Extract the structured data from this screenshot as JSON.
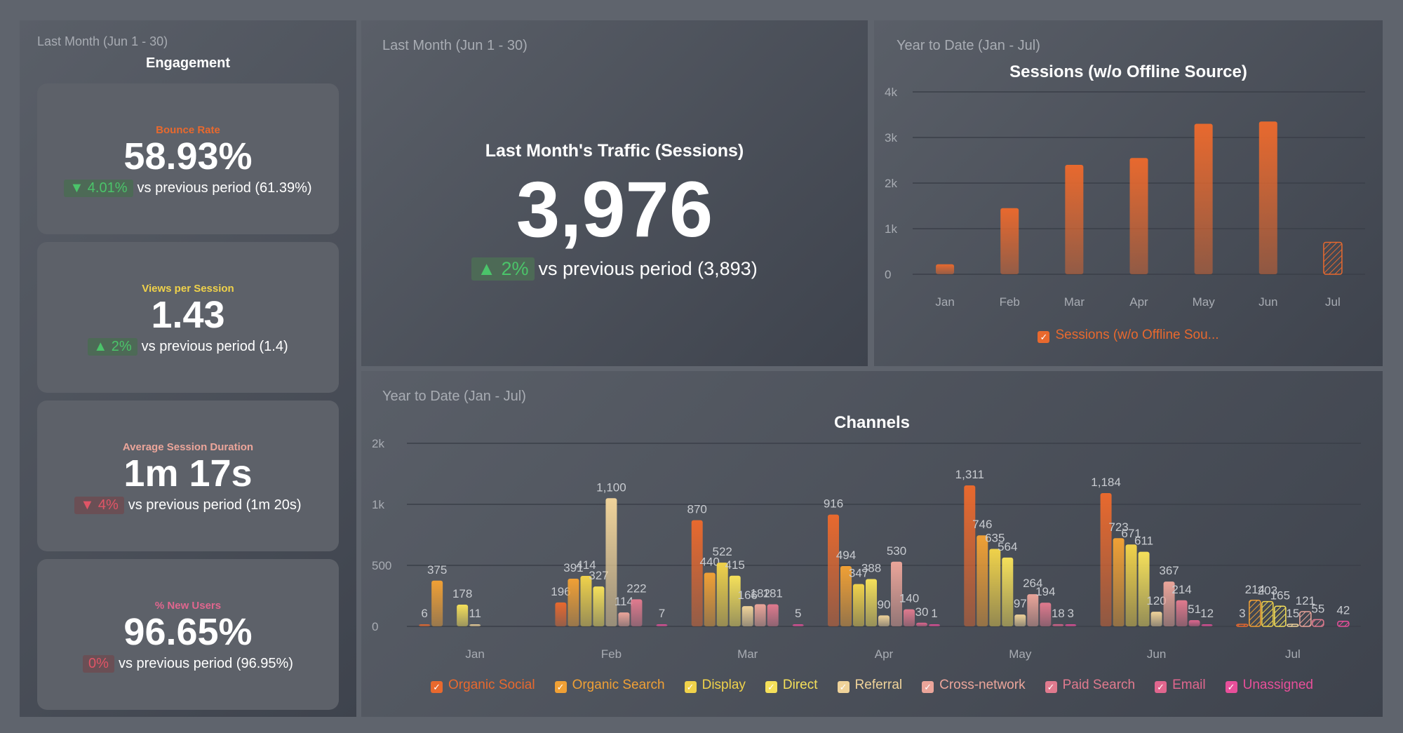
{
  "engagement": {
    "period": "Last Month (Jun 1 - 30)",
    "title": "Engagement",
    "cards": [
      {
        "label": "Bounce Rate",
        "label_color": "#e8692e",
        "value": "58.93%",
        "change": "▼ 4.01%",
        "direction": "down-good",
        "compare": "vs previous period (61.39%)"
      },
      {
        "label": "Views per Session",
        "label_color": "#f0d24a",
        "value": "1.43",
        "change": "▲ 2%",
        "direction": "up",
        "compare": "vs previous period (1.4)"
      },
      {
        "label": "Average Session Duration",
        "label_color": "#eba59a",
        "value": "1m 17s",
        "change": "▼ 4%",
        "direction": "down",
        "compare": "vs previous period (1m 20s)"
      },
      {
        "label": "% New Users",
        "label_color": "#e0668e",
        "value": "96.65%",
        "change": "0%",
        "direction": "down",
        "compare": "vs previous period (96.95%)"
      }
    ]
  },
  "traffic": {
    "period": "Last Month (Jun 1 - 30)",
    "title": "Last Month's Traffic (Sessions)",
    "value": "3,976",
    "change": "▲ 2%",
    "compare": "vs previous period (3,893)"
  },
  "chart_data": [
    {
      "type": "bar",
      "period": "Year to Date (Jan - Jul)",
      "title": "Sessions (w/o Offline Source)",
      "categories": [
        "Jan",
        "Feb",
        "Mar",
        "Apr",
        "May",
        "Jun",
        "Jul"
      ],
      "y_ticks": [
        "0",
        "1k",
        "2k",
        "3k",
        "4k"
      ],
      "ylim": [
        0,
        4000
      ],
      "grid": true,
      "legend": "bottom",
      "series": [
        {
          "name": "Sessions (w/o Offline Sou...",
          "color": "#e8692e",
          "values": [
            220,
            1450,
            2400,
            2550,
            3300,
            3350,
            700
          ]
        }
      ],
      "partial_last": true
    },
    {
      "type": "bar",
      "period": "Year to Date (Jan - Jul)",
      "title": "Channels",
      "categories": [
        "Jan",
        "Feb",
        "Mar",
        "Apr",
        "May",
        "Jun",
        "Jul"
      ],
      "y_ticks": [
        "0",
        "500",
        "1k",
        "2k"
      ],
      "ylim": [
        0,
        1500
      ],
      "grid": true,
      "legend": "bottom",
      "partial_last": true,
      "series": [
        {
          "name": "Organic Social",
          "color": "#e8692e",
          "values": [
            6,
            196,
            870,
            916,
            1311,
            1184,
            3
          ]
        },
        {
          "name": "Organic Search",
          "color": "#f0a035",
          "values": [
            375,
            391,
            440,
            494,
            746,
            723,
            214
          ]
        },
        {
          "name": "Display",
          "color": "#f0d24a",
          "values": [
            null,
            414,
            522,
            347,
            635,
            671,
            203
          ]
        },
        {
          "name": "Direct",
          "color": "#f5e05a",
          "values": [
            178,
            327,
            415,
            388,
            564,
            611,
            165
          ]
        },
        {
          "name": "Referral",
          "color": "#f0d39a",
          "values": [
            11,
            1100,
            166,
            90,
            97,
            120,
            15
          ]
        },
        {
          "name": "Cross-network",
          "color": "#eba59a",
          "values": [
            null,
            114,
            182,
            530,
            264,
            367,
            121
          ]
        },
        {
          "name": "Paid Search",
          "color": "#e07a8e",
          "values": [
            null,
            222,
            181,
            140,
            194,
            214,
            55
          ]
        },
        {
          "name": "Email",
          "color": "#e0668e",
          "values": [
            null,
            null,
            null,
            30,
            18,
            51,
            null
          ]
        },
        {
          "name": "Unassigned",
          "color": "#e84f9a",
          "values": [
            null,
            7,
            5,
            1,
            3,
            12,
            42
          ]
        }
      ]
    }
  ]
}
